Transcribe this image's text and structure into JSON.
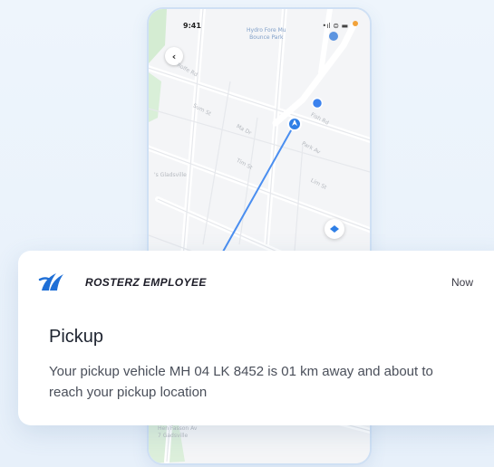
{
  "phone": {
    "status_time": "9:41",
    "status_right": "•ıl ⊜ ▬",
    "back_glyph": "‹",
    "map_labels": {
      "park": "Hydro Fore Mu\nBounce Park",
      "street_1": "Rolfe Rd",
      "street_2": "Sum St",
      "street_3": "Ma Dr",
      "street_4": "Fish Rd",
      "street_5": "Park Av",
      "street_6": "Tim St",
      "street_7": "Lim St",
      "town": "'s Gladsville",
      "bottom": "Hen Fasson Av\n7 Gadsville"
    }
  },
  "notification": {
    "app_name": "ROSTERZ EMPLOYEE",
    "time": "Now",
    "title": "Pickup",
    "message": "Your pickup vehicle MH 04 LK 8452 is 01 km away and about to reach your pickup location"
  },
  "colors": {
    "accent": "#2f7fe6",
    "route": "#4a8ef0",
    "logo": "#1f6fd6",
    "background": "#e9f2fb"
  }
}
